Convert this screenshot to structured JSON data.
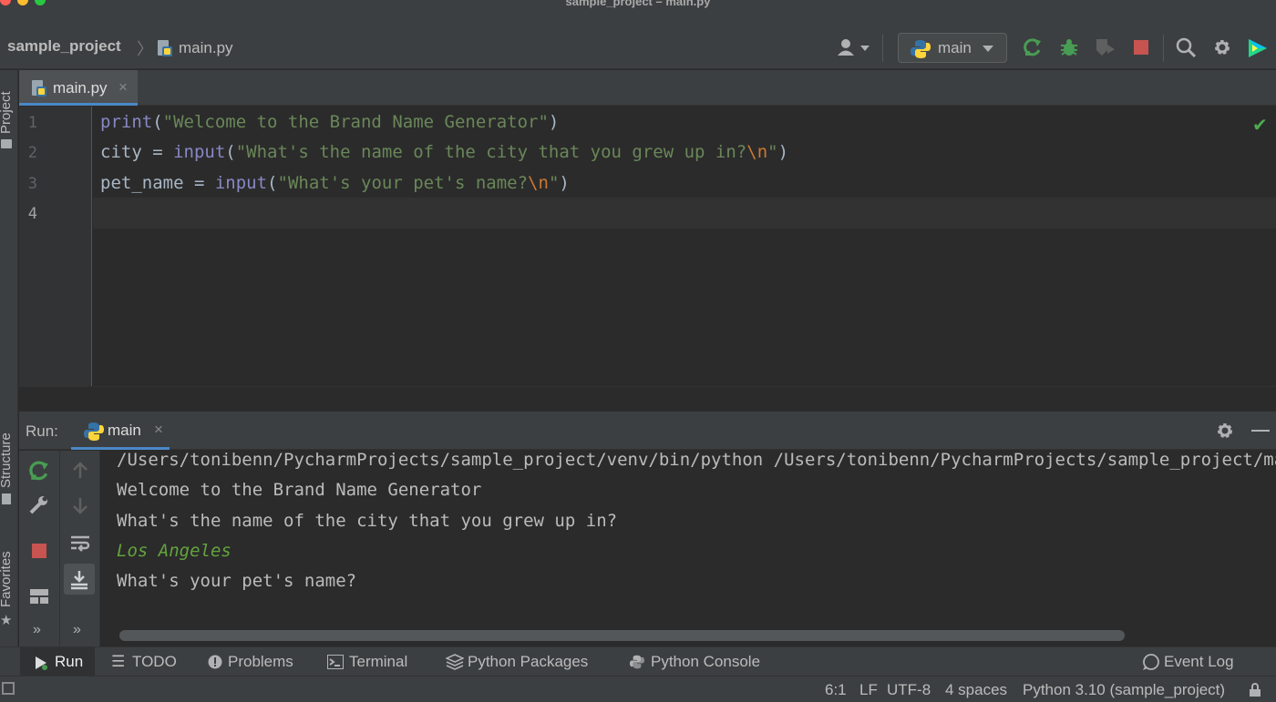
{
  "window": {
    "title": "sample_project – main.py"
  },
  "navbar": {
    "project": "sample_project",
    "separator": "〉",
    "file": "main.py",
    "run_config": "main"
  },
  "left_stripe": {
    "project": "Project",
    "structure": "Structure",
    "favorites": "Favorites"
  },
  "editor": {
    "tab_label": "main.py",
    "tab_close": "×",
    "lines": [
      {
        "num": "1"
      },
      {
        "num": "2"
      },
      {
        "num": "3"
      },
      {
        "num": "4"
      }
    ],
    "code": {
      "l1_fn": "print",
      "l1_open": "(",
      "l1_str": "\"Welcome to the Brand Name Generator\"",
      "l1_close": ")",
      "l2_var": "city = ",
      "l2_fn": "input",
      "l2_open": "(",
      "l2_str": "\"What's the name of the city that you grew up in?",
      "l2_esc": "\\n",
      "l2_end": "\"",
      "l2_close": ")",
      "l3_var": "pet_name = ",
      "l3_fn": "input",
      "l3_open": "(",
      "l3_str": "\"What's your pet's name?",
      "l3_esc": "\\n",
      "l3_end": "\"",
      "l3_close": ")"
    },
    "check": "✔"
  },
  "run": {
    "label": "Run:",
    "tab_label": "main",
    "tab_close": "×",
    "console": {
      "command": "/Users/tonibenn/PycharmProjects/sample_project/venv/bin/python /Users/tonibenn/PycharmProjects/sample_project/main.py",
      "out1": "Welcome to the Brand Name Generator",
      "out2": "What's the name of the city that you grew up in?",
      "user_input": "Los Angeles",
      "out3": "What's your pet's name?"
    },
    "more1": "»",
    "more2": "»"
  },
  "bottom_bar": {
    "run": "Run",
    "todo": "TODO",
    "problems": "Problems",
    "terminal": "Terminal",
    "python_packages": "Python Packages",
    "python_console": "Python Console",
    "event_log": "Event Log"
  },
  "status_bar": {
    "position": "6:1",
    "line_sep": "LF",
    "encoding": "UTF-8",
    "indent": "4 spaces",
    "interpreter": "Python 3.10 (sample_project)"
  },
  "colors": {
    "background": "#2b2b2b",
    "chrome": "#3c3f41",
    "accent": "#4a88c7",
    "string": "#6a8759",
    "builtin": "#8888c6",
    "escape": "#cc7832",
    "run_green": "#499c54",
    "stop_red": "#c75450"
  }
}
